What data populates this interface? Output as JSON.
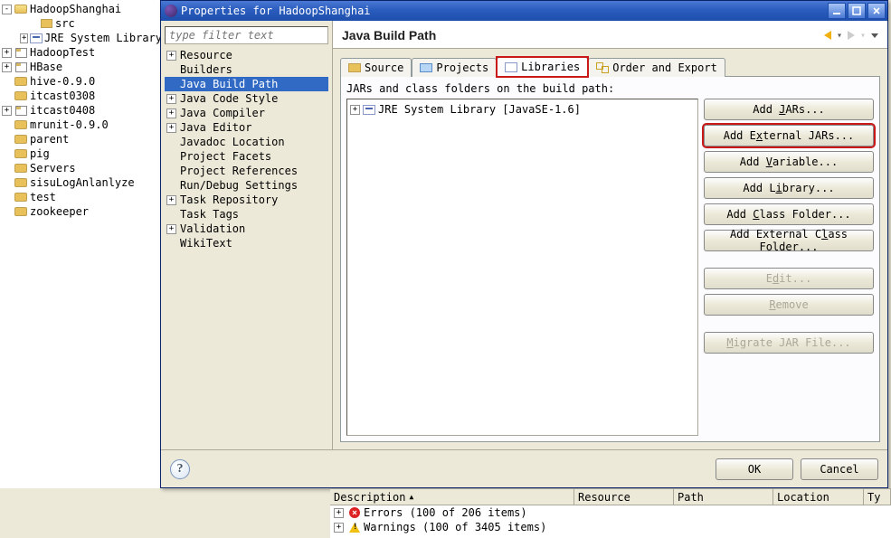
{
  "explorer": {
    "items": [
      {
        "t": "HadoopShanghai",
        "i": 0,
        "e": "-",
        "ic": "folder-open"
      },
      {
        "t": "src",
        "i": 2,
        "e": "",
        "ic": "pkg-icon"
      },
      {
        "t": "JRE System Library",
        "i": 2,
        "e": "+",
        "ic": "jre-icon"
      },
      {
        "t": "HadoopTest",
        "i": 0,
        "e": "+",
        "ic": "proj-icon"
      },
      {
        "t": "HBase",
        "i": 0,
        "e": "+",
        "ic": "proj-icon"
      },
      {
        "t": "hive-0.9.0",
        "i": 0,
        "e": "",
        "ic": "folder-closed"
      },
      {
        "t": "itcast0308",
        "i": 0,
        "e": "",
        "ic": "folder-closed"
      },
      {
        "t": "itcast0408",
        "i": 0,
        "e": "+",
        "ic": "proj-icon"
      },
      {
        "t": "mrunit-0.9.0",
        "i": 0,
        "e": "",
        "ic": "folder-closed"
      },
      {
        "t": "parent",
        "i": 0,
        "e": "",
        "ic": "folder-closed"
      },
      {
        "t": "pig",
        "i": 0,
        "e": "",
        "ic": "folder-closed"
      },
      {
        "t": "Servers",
        "i": 0,
        "e": "",
        "ic": "folder-closed"
      },
      {
        "t": "sisuLogAnlanlyze",
        "i": 0,
        "e": "",
        "ic": "folder-closed"
      },
      {
        "t": "test",
        "i": 0,
        "e": "",
        "ic": "folder-closed"
      },
      {
        "t": "zookeeper",
        "i": 0,
        "e": "",
        "ic": "folder-closed"
      }
    ]
  },
  "dialog": {
    "title": "Properties for HadoopShanghai",
    "filter_placeholder": "type filter text",
    "tree": [
      {
        "exp": "+",
        "label": "Resource"
      },
      {
        "exp": "",
        "label": "Builders"
      },
      {
        "exp": "",
        "label": "Java Build Path",
        "sel": true
      },
      {
        "exp": "+",
        "label": "Java Code Style"
      },
      {
        "exp": "+",
        "label": "Java Compiler"
      },
      {
        "exp": "+",
        "label": "Java Editor"
      },
      {
        "exp": "",
        "label": "Javadoc Location"
      },
      {
        "exp": "",
        "label": "Project Facets"
      },
      {
        "exp": "",
        "label": "Project References"
      },
      {
        "exp": "",
        "label": "Run/Debug Settings"
      },
      {
        "exp": "+",
        "label": "Task Repository"
      },
      {
        "exp": "",
        "label": "Task Tags"
      },
      {
        "exp": "+",
        "label": "Validation"
      },
      {
        "exp": "",
        "label": "WikiText"
      }
    ],
    "header": "Java Build Path",
    "tabs": {
      "source": "Source",
      "projects": "Projects",
      "libraries": "Libraries",
      "order": "Order and Export"
    },
    "pane_label": "JARs and class folders on the build path:",
    "jar_item": "JRE System Library [JavaSE-1.6]",
    "buttons": {
      "add_jars": "Add JARs...",
      "add_ext_jars": "Add External JARs...",
      "add_var": "Add Variable...",
      "add_lib": "Add Library...",
      "add_cf": "Add Class Folder...",
      "add_ext_cf": "Add External Class Folder...",
      "edit": "Edit...",
      "remove": "Remove",
      "migrate": "Migrate JAR File..."
    },
    "footer": {
      "ok": "OK",
      "cancel": "Cancel"
    }
  },
  "problems": {
    "cols": {
      "desc": "Description",
      "res": "Resource",
      "path": "Path",
      "loc": "Location",
      "typ": "Ty"
    },
    "errors": "Errors (100 of 206 items)",
    "warnings": "Warnings (100 of 3405 items)"
  },
  "underline": {
    "J": "J",
    "x": "x",
    "V": "V",
    "i": "i",
    "C": "C",
    "l": "l",
    "d": "d",
    "R": "R",
    "M": "M",
    "S": "S",
    "P": "P",
    "L": "L",
    "O": "O"
  }
}
